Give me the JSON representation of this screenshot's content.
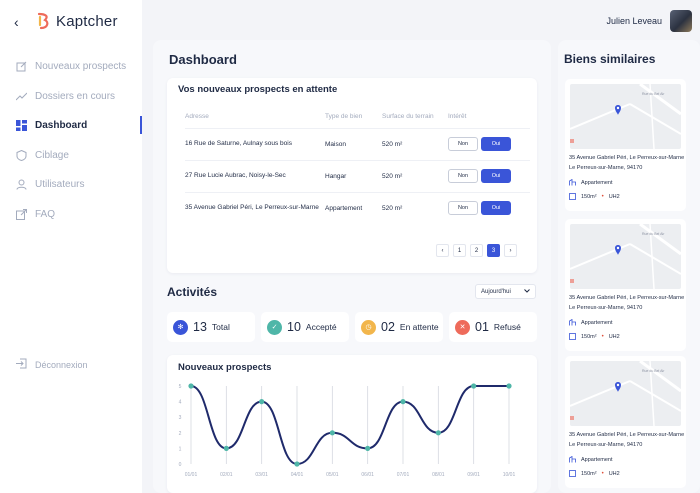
{
  "app": {
    "name": "Kaptcher"
  },
  "user": {
    "name": "Julien Leveau"
  },
  "sidebar": {
    "items": [
      {
        "label": "Nouveaux prospects",
        "icon": "edit-icon"
      },
      {
        "label": "Dossiers en cours",
        "icon": "trend-icon"
      },
      {
        "label": "Dashboard",
        "icon": "grid-icon",
        "active": true
      },
      {
        "label": "Ciblage",
        "icon": "shield-icon"
      },
      {
        "label": "Utilisateurs",
        "icon": "user-icon"
      },
      {
        "label": "FAQ",
        "icon": "external-icon"
      }
    ],
    "logout": "Déconnexion"
  },
  "dashboard": {
    "title": "Dashboard",
    "prospects": {
      "title": "Vos nouveaux prospects en attente",
      "columns": [
        "Adresse",
        "Type de bien",
        "Surface du terrain",
        "Intérêt"
      ],
      "rows": [
        {
          "adresse": "16 Rue de Saturne, Aulnay sous bois",
          "type": "Maison",
          "surface": "520 m²",
          "non": "Non",
          "oui": "Oui"
        },
        {
          "adresse": "27 Rue Lucie Aubrac, Noisy-le-Sec",
          "type": "Hangar",
          "surface": "520 m²",
          "non": "Non",
          "oui": "Oui"
        },
        {
          "adresse": "35 Avenue Gabriel Péri, Le Perreux-sur-Marne",
          "type": "Appartement",
          "surface": "520 m²",
          "non": "Non",
          "oui": "Oui"
        }
      ],
      "pagination": {
        "prev": "‹",
        "pages": [
          "1",
          "2",
          "3"
        ],
        "active": "3",
        "next": "›"
      }
    },
    "activites": {
      "title": "Activités",
      "filter": "Aujourd'hui",
      "stats": [
        {
          "count": "13",
          "label": "Total",
          "color": "#3a55d8"
        },
        {
          "count": "10",
          "label": "Accepté",
          "color": "#4fb6a8"
        },
        {
          "count": "02",
          "label": "En attente",
          "color": "#f2b64c"
        },
        {
          "count": "01",
          "label": "Refusé",
          "color": "#ee6b5b"
        }
      ]
    },
    "chart_title": "Nouveaux prospects"
  },
  "chart_data": {
    "type": "line",
    "title": "Nouveaux prospects",
    "categories": [
      "01/01",
      "02/01",
      "03/01",
      "04/01",
      "05/01",
      "06/01",
      "07/01",
      "08/01",
      "09/01",
      "10/01"
    ],
    "values": [
      5,
      1,
      4,
      0,
      2,
      1,
      4,
      2,
      5,
      5
    ],
    "ylim": [
      0,
      5
    ],
    "yticks": [
      "0",
      "1",
      "2",
      "3",
      "4",
      "5"
    ],
    "line_color": "#1f2a6b",
    "point_color": "#4fb6a8"
  },
  "similaires": {
    "title": "Biens similaires",
    "items": [
      {
        "address": "35 Avenue Gabriel Péri, Le Perreux-sur-Marne Le Perreux-sur-Marne, 94170",
        "type": "Appartement",
        "surface": "150m²",
        "zone": "UH2",
        "map_street": "Rue du Bel Air"
      },
      {
        "address": "35 Avenue Gabriel Péri, Le Perreux-sur-Marne Le Perreux-sur-Marne, 94170",
        "type": "Appartement",
        "surface": "150m²",
        "zone": "UH2",
        "map_street": "Rue du Bel Air"
      },
      {
        "address": "35 Avenue Gabriel Péri, Le Perreux-sur-Marne Le Perreux-sur-Marne, 94170",
        "type": "Appartement",
        "surface": "150m²",
        "zone": "UH2",
        "map_street": "Rue du Bel Air"
      }
    ]
  }
}
